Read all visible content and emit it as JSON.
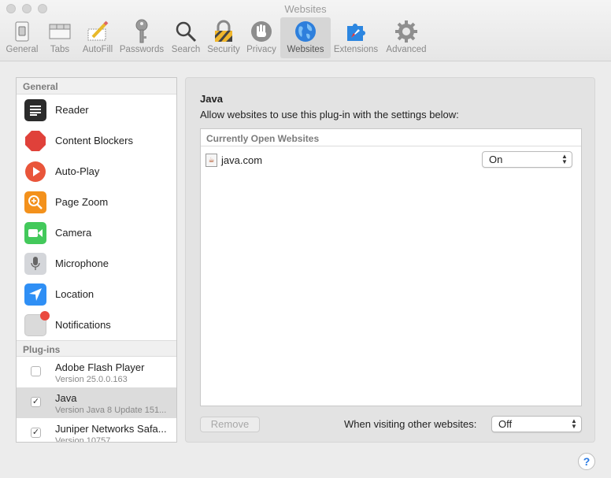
{
  "window": {
    "title": "Websites"
  },
  "toolbar": {
    "items": [
      {
        "label": "General",
        "icon": "general-switch-icon"
      },
      {
        "label": "Tabs",
        "icon": "tabs-icon"
      },
      {
        "label": "AutoFill",
        "icon": "pencil-form-icon"
      },
      {
        "label": "Passwords",
        "icon": "key-icon"
      },
      {
        "label": "Search",
        "icon": "magnifier-icon"
      },
      {
        "label": "Security",
        "icon": "padlock-icon"
      },
      {
        "label": "Privacy",
        "icon": "hand-icon"
      },
      {
        "label": "Websites",
        "icon": "globe-icon",
        "active": true
      },
      {
        "label": "Extensions",
        "icon": "puzzle-icon"
      },
      {
        "label": "Advanced",
        "icon": "gear-icon"
      }
    ]
  },
  "sidebar": {
    "general_header": "General",
    "items": [
      {
        "label": "Reader",
        "icon": "reader-icon",
        "color": "#2b2b2b"
      },
      {
        "label": "Content Blockers",
        "icon": "stop-icon",
        "color": "#e0413a"
      },
      {
        "label": "Auto-Play",
        "icon": "play-icon",
        "color": "#e9553a"
      },
      {
        "label": "Page Zoom",
        "icon": "zoom-icon",
        "color": "#f3911c"
      },
      {
        "label": "Camera",
        "icon": "camera-icon",
        "color": "#43c95b"
      },
      {
        "label": "Microphone",
        "icon": "microphone-icon",
        "color": "#d4d6da"
      },
      {
        "label": "Location",
        "icon": "location-arrow-icon",
        "color": "#2f8ff5"
      },
      {
        "label": "Notifications",
        "icon": "notification-icon",
        "color": "#d9d9d9"
      }
    ],
    "plugins_header": "Plug-ins",
    "plugins": [
      {
        "name": "Adobe Flash Player",
        "version": "Version 25.0.0.163",
        "checked": false,
        "selected": false
      },
      {
        "name": "Java",
        "version": "Version Java 8 Update 151...",
        "checked": true,
        "selected": true
      },
      {
        "name": "Juniper Networks Safa...",
        "version": "Version 10757",
        "checked": true,
        "selected": false
      }
    ]
  },
  "main": {
    "plugin_title": "Java",
    "description": "Allow websites to use this plug-in with the settings below:",
    "list_header": "Currently Open Websites",
    "sites": [
      {
        "name": "java.com",
        "setting": "On"
      }
    ],
    "remove_label": "Remove",
    "visiting_label": "When visiting other websites:",
    "visiting_value": "Off"
  },
  "help": {
    "label": "?"
  },
  "colors": {
    "accent": "#2a7ae2",
    "selected_row": "#dcdcdc"
  }
}
